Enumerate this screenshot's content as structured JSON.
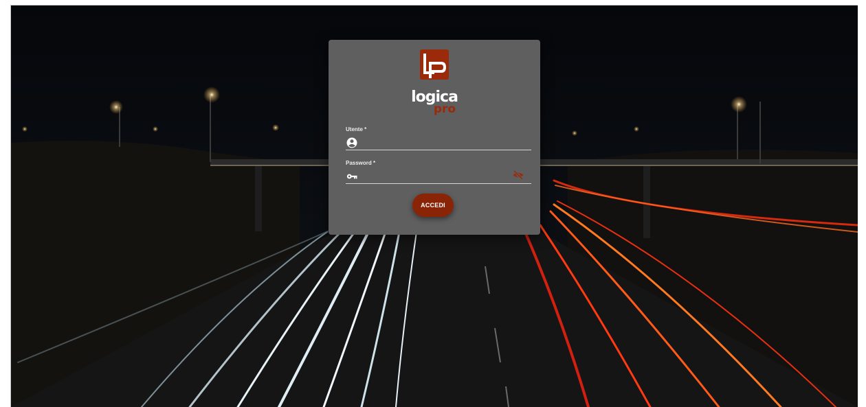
{
  "login": {
    "brand": {
      "main": "logica",
      "sub": "pro",
      "mark": "lp"
    },
    "username": {
      "label": "Utente *",
      "value": "",
      "placeholder": ""
    },
    "password": {
      "label": "Password *",
      "value": "",
      "placeholder": ""
    },
    "submit_label": "ACCEDI"
  },
  "colors": {
    "accent": "#8a2407",
    "card": "#5f5f5f",
    "brand_sub": "#9a2a0a"
  },
  "icons": {
    "username": "account-circle-icon",
    "password": "key-icon",
    "toggle": "eye-off-icon"
  }
}
